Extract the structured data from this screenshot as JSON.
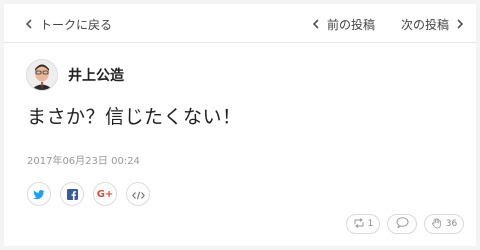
{
  "nav": {
    "back_label": "トークに戻る",
    "prev_label": "前の投稿",
    "next_label": "次の投稿"
  },
  "post": {
    "author": "井上公造",
    "text": "まさか？信じたくない！",
    "date": "2017年06月23日 00:24"
  },
  "share_buttons": [
    {
      "icon": "twitter-icon",
      "color": "#1da1f2"
    },
    {
      "icon": "facebook-icon",
      "color": "#3b5998"
    },
    {
      "icon": "google-plus-icon",
      "color": "#dd4b39"
    },
    {
      "icon": "embed-code-icon",
      "color": "#666666"
    }
  ],
  "actions": {
    "retalk_count": "1",
    "like_count": "36"
  }
}
